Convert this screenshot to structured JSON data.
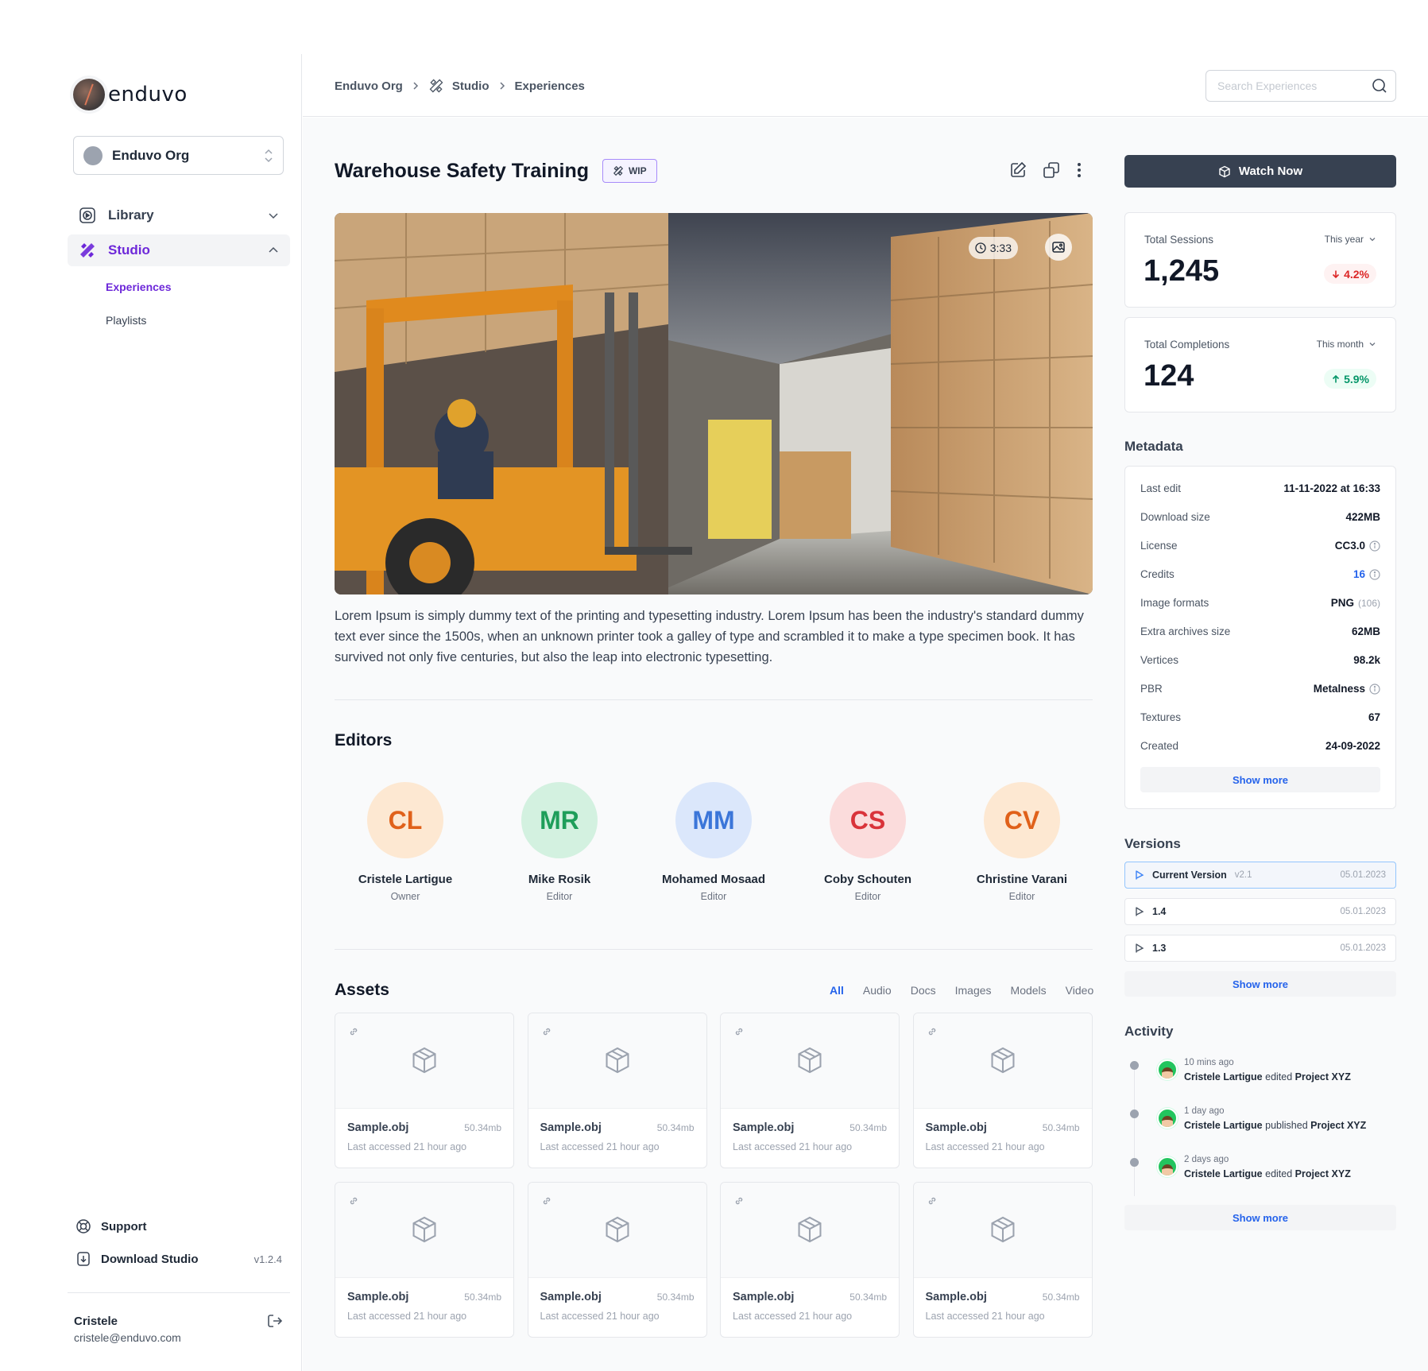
{
  "brand": {
    "name": "enduvo"
  },
  "org_select": {
    "name": "Enduvo Org"
  },
  "nav": {
    "library": "Library",
    "studio": "Studio",
    "studio_sub": [
      "Experiences",
      "Playlists"
    ]
  },
  "sidebar_bottom": {
    "support": "Support",
    "download": "Download Studio",
    "version": "v1.2.4"
  },
  "user": {
    "name": "Cristele",
    "email": "cristele@enduvo.com"
  },
  "breadcrumb": [
    "Enduvo Org",
    "Studio",
    "Experiences"
  ],
  "search": {
    "placeholder": "Search Experiences"
  },
  "experience": {
    "title": "Warehouse Safety Training",
    "badge": "WIP",
    "duration": "3:33",
    "description": "Lorem Ipsum is simply dummy text of the printing and typesetting industry. Lorem Ipsum has been the industry's standard dummy text ever since the 1500s, when an unknown printer took a galley of type and scrambled it to make a type specimen book. It has survived not only five centuries, but also the leap into electronic typesetting."
  },
  "editors": {
    "title": "Editors",
    "items": [
      {
        "initials": "CL",
        "name": "Cristele Lartigue",
        "role": "Owner",
        "bg": "#fde8d2",
        "fg": "#e0611a"
      },
      {
        "initials": "MR",
        "name": "Mike Rosik",
        "role": "Editor",
        "bg": "#d3f1e0",
        "fg": "#1e9e5a"
      },
      {
        "initials": "MM",
        "name": "Mohamed Mosaad",
        "role": "Editor",
        "bg": "#dbe7fb",
        "fg": "#3b76d9"
      },
      {
        "initials": "CS",
        "name": "Coby Schouten",
        "role": "Editor",
        "bg": "#fbdcdc",
        "fg": "#d9333a"
      },
      {
        "initials": "CV",
        "name": "Christine Varani",
        "role": "Editor",
        "bg": "#fde8d2",
        "fg": "#e0611a"
      }
    ]
  },
  "assets": {
    "title": "Assets",
    "filters": [
      "All",
      "Audio",
      "Docs",
      "Images",
      "Models",
      "Video"
    ],
    "active_filter": "All",
    "items": [
      {
        "name": "Sample.obj",
        "size": "50.34mb",
        "meta": "Last accessed 21 hour ago"
      },
      {
        "name": "Sample.obj",
        "size": "50.34mb",
        "meta": "Last accessed 21 hour ago"
      },
      {
        "name": "Sample.obj",
        "size": "50.34mb",
        "meta": "Last accessed 21 hour ago"
      },
      {
        "name": "Sample.obj",
        "size": "50.34mb",
        "meta": "Last accessed 21 hour ago"
      },
      {
        "name": "Sample.obj",
        "size": "50.34mb",
        "meta": "Last accessed 21 hour ago"
      },
      {
        "name": "Sample.obj",
        "size": "50.34mb",
        "meta": "Last accessed 21 hour ago"
      },
      {
        "name": "Sample.obj",
        "size": "50.34mb",
        "meta": "Last accessed 21 hour ago"
      },
      {
        "name": "Sample.obj",
        "size": "50.34mb",
        "meta": "Last accessed 21 hour ago"
      }
    ]
  },
  "watch_button": "Watch Now",
  "stats": [
    {
      "label": "Total Sessions",
      "period": "This year",
      "value": "1,245",
      "delta": "4.2%",
      "direction": "down"
    },
    {
      "label": "Total Completions",
      "period": "This month",
      "value": "124",
      "delta": "5.9%",
      "direction": "up"
    }
  ],
  "metadata": {
    "title": "Metadata",
    "rows": [
      {
        "key": "Last edit",
        "value": "11-11-2022 at 16:33"
      },
      {
        "key": "Download size",
        "value": "422MB"
      },
      {
        "key": "License",
        "value": "CC3.0",
        "info": true
      },
      {
        "key": "Credits",
        "value": "16",
        "info": true,
        "link": true
      },
      {
        "key": "Image formats",
        "value": "PNG",
        "sub": "(106)"
      },
      {
        "key": "Extra archives size",
        "value": "62MB"
      },
      {
        "key": "Vertices",
        "value": "98.2k"
      },
      {
        "key": "PBR",
        "value": "Metalness",
        "info": true
      },
      {
        "key": "Textures",
        "value": "67"
      },
      {
        "key": "Created",
        "value": "24-09-2022"
      }
    ],
    "show_more": "Show more"
  },
  "versions": {
    "title": "Versions",
    "items": [
      {
        "name": "Current Version",
        "tag": "v2.1",
        "date": "05.01.2023"
      },
      {
        "name": "1.4",
        "tag": "",
        "date": "05.01.2023"
      },
      {
        "name": "1.3",
        "tag": "",
        "date": "05.01.2023"
      }
    ],
    "show_more": "Show more"
  },
  "activity": {
    "title": "Activity",
    "items": [
      {
        "time": "10 mins ago",
        "user": "Cristele Lartigue",
        "action": "edited",
        "target": "Project XYZ"
      },
      {
        "time": "1 day ago",
        "user": "Cristele Lartigue",
        "action": "published",
        "target": "Project XYZ"
      },
      {
        "time": "2 days ago",
        "user": "Cristele Lartigue",
        "action": "edited",
        "target": "Project XYZ"
      }
    ],
    "show_more": "Show more"
  },
  "colors": {
    "accent": "#6d28d9",
    "link": "#2563eb",
    "primary_button": "#374151"
  }
}
